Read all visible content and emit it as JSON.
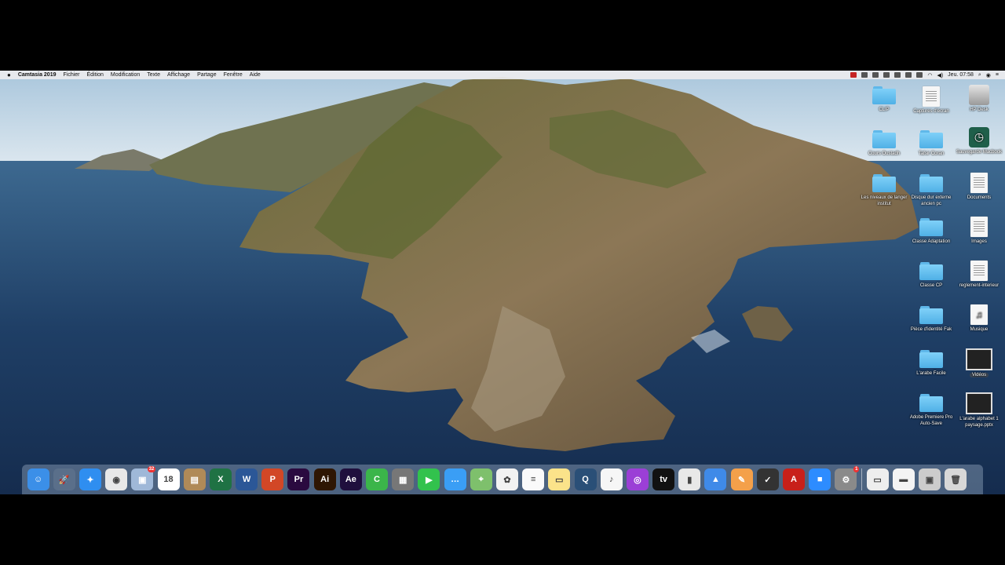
{
  "menubar": {
    "app_name": "Camtasia 2019",
    "menus": [
      "Fichier",
      "Édition",
      "Modification",
      "Texte",
      "Affichage",
      "Partage",
      "Fenêtre",
      "Aide"
    ],
    "clock": "Jeu. 07:58",
    "status_icons": [
      "record-icon",
      "dropbox-icon",
      "sync-icon",
      "screen-icon",
      "display-icon",
      "cast-icon",
      "bluetooth-icon",
      "wifi-icon",
      "volume-icon",
      "spotlight-icon",
      "siri-icon",
      "notification-center-icon"
    ]
  },
  "desktop_icons": [
    {
      "label": "CLIP",
      "type": "folder"
    },
    {
      "label": "Captures d'écran",
      "type": "doc"
    },
    {
      "label": "HP Desk",
      "type": "drive"
    },
    {
      "label": "Cours Oustadh",
      "type": "folder"
    },
    {
      "label": "Tafsir Coran",
      "type": "folder"
    },
    {
      "label": "Sauvegarde Macbook",
      "type": "timemachine"
    },
    {
      "label": "Les niveaux de langer institut",
      "type": "folder"
    },
    {
      "label": "Disque dur externe ancien pc",
      "type": "folder"
    },
    {
      "label": "Documents",
      "type": "doc"
    },
    {
      "label": "Classe Adaptation",
      "type": "folder"
    },
    {
      "label": "Images",
      "type": "doc"
    },
    {
      "label": "Classe CP",
      "type": "folder"
    },
    {
      "label": "reglement-interieur",
      "type": "doc"
    },
    {
      "label": "Pièce d'identité Fak",
      "type": "folder"
    },
    {
      "label": "Musique",
      "type": "doc"
    },
    {
      "label": "L'arabe Facile",
      "type": "folder"
    },
    {
      "label": "Vidéos",
      "type": "thumb"
    },
    {
      "label": "Adobe Premiere Pro Auto-Save",
      "type": "folder"
    },
    {
      "label": "L'arabe alphabet 1 paysage.pptx",
      "type": "thumb"
    }
  ],
  "dock": {
    "apps": [
      {
        "name": "finder-icon",
        "color": "#3b8fe8",
        "glyph": "☺"
      },
      {
        "name": "launchpad-icon",
        "color": "#5a6f8a",
        "glyph": "🚀"
      },
      {
        "name": "safari-icon",
        "color": "#2f8ef0",
        "glyph": "✦"
      },
      {
        "name": "chrome-icon",
        "color": "#e8e8e8",
        "glyph": "◉"
      },
      {
        "name": "preview-icon",
        "color": "#9fb8d8",
        "glyph": "▣",
        "badge": "32"
      },
      {
        "name": "calendar-icon",
        "color": "#ffffff",
        "glyph": "18"
      },
      {
        "name": "contacts-icon",
        "color": "#b08a58",
        "glyph": "▤"
      },
      {
        "name": "excel-icon",
        "color": "#1f7244",
        "glyph": "X"
      },
      {
        "name": "word-icon",
        "color": "#2b5797",
        "glyph": "W"
      },
      {
        "name": "powerpoint-icon",
        "color": "#d24726",
        "glyph": "P"
      },
      {
        "name": "premiere-icon",
        "color": "#2a0a3f",
        "glyph": "Pr"
      },
      {
        "name": "illustrator-icon",
        "color": "#2e1603",
        "glyph": "Ai"
      },
      {
        "name": "after-effects-icon",
        "color": "#1f0f3d",
        "glyph": "Ae"
      },
      {
        "name": "camtasia-icon",
        "color": "#3bb54a",
        "glyph": "C"
      },
      {
        "name": "calculator-icon",
        "color": "#777777",
        "glyph": "▦"
      },
      {
        "name": "facetime-icon",
        "color": "#32c24d",
        "glyph": "▶"
      },
      {
        "name": "messages-icon",
        "color": "#3a9ef5",
        "glyph": "…"
      },
      {
        "name": "maps-icon",
        "color": "#7ec06c",
        "glyph": "⌖"
      },
      {
        "name": "photos-icon",
        "color": "#f2f2f2",
        "glyph": "✿"
      },
      {
        "name": "reminders-icon",
        "color": "#fafafa",
        "glyph": "≡"
      },
      {
        "name": "notes-icon",
        "color": "#fbe38a",
        "glyph": "▭"
      },
      {
        "name": "quicktime-icon",
        "color": "#2a4f77",
        "glyph": "Q"
      },
      {
        "name": "music-icon",
        "color": "#f6f6f6",
        "glyph": "♪"
      },
      {
        "name": "podcasts-icon",
        "color": "#9b3fd6",
        "glyph": "◎"
      },
      {
        "name": "tv-icon",
        "color": "#111111",
        "glyph": "tv"
      },
      {
        "name": "numbers-icon",
        "color": "#e8e8e8",
        "glyph": "▮"
      },
      {
        "name": "keynote-icon",
        "color": "#3f8ae8",
        "glyph": "▲"
      },
      {
        "name": "pages-icon",
        "color": "#f4a04a",
        "glyph": "✎"
      },
      {
        "name": "norton-icon",
        "color": "#333333",
        "glyph": "✓"
      },
      {
        "name": "acrobat-icon",
        "color": "#c8201a",
        "glyph": "A"
      },
      {
        "name": "zoom-icon",
        "color": "#2d8cff",
        "glyph": "■"
      },
      {
        "name": "system-preferences-icon",
        "color": "#8a8a8a",
        "glyph": "⚙",
        "badge": "1"
      }
    ],
    "stacks": [
      {
        "name": "downloads-stack-icon",
        "color": "#eeeeee",
        "glyph": "▭"
      },
      {
        "name": "window-stack-icon",
        "color": "#f4f4f4",
        "glyph": "▬"
      },
      {
        "name": "screenshots-stack-icon",
        "color": "#cccccc",
        "glyph": "▣"
      },
      {
        "name": "trash-icon",
        "color": "#d8d8d8",
        "glyph": "🗑"
      }
    ]
  }
}
